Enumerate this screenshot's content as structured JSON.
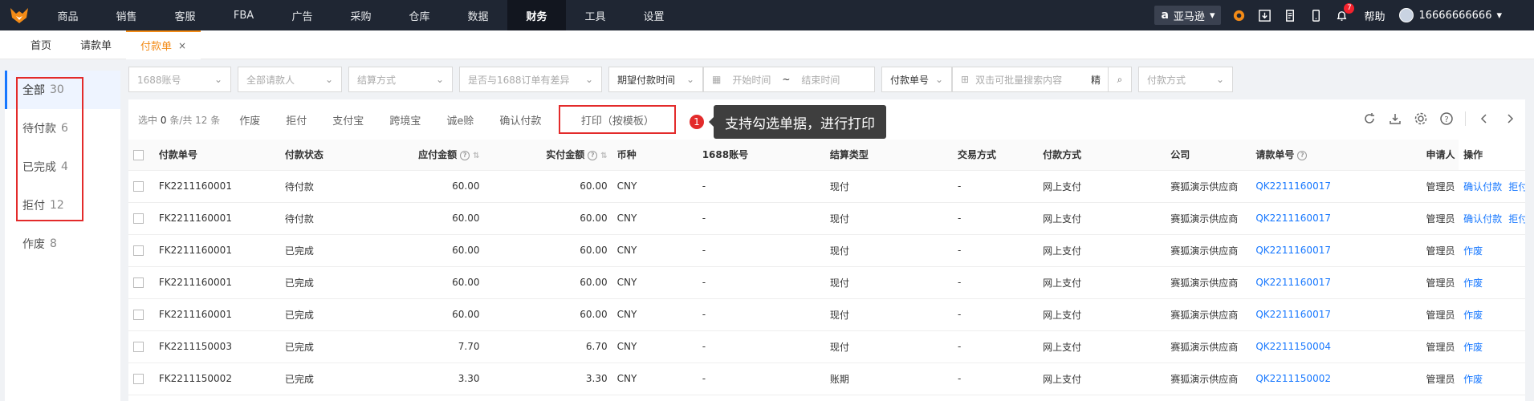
{
  "nav": {
    "items": [
      "商品",
      "销售",
      "客服",
      "FBA",
      "广告",
      "采购",
      "仓库",
      "数据",
      "财务",
      "工具",
      "设置"
    ],
    "active_index": 8,
    "platform": "亚马逊",
    "help": "帮助",
    "user": "16666666666",
    "notification_count": "7"
  },
  "tabs": [
    {
      "label": "首页"
    },
    {
      "label": "请款单"
    },
    {
      "label": "付款单",
      "close": "×"
    }
  ],
  "status_list": [
    {
      "label": "全部",
      "count": "30"
    },
    {
      "label": "待付款",
      "count": "6"
    },
    {
      "label": "已完成",
      "count": "4"
    },
    {
      "label": "拒付",
      "count": "12"
    },
    {
      "label": "作废",
      "count": "8"
    }
  ],
  "filters": {
    "account": "1688账号",
    "requester": "全部请款人",
    "settle": "结算方式",
    "diff": "是否与1688订单有差异",
    "date_type": "期望付款时间",
    "start": "开始时间",
    "tilde": "~",
    "end": "结束时间",
    "search_type": "付款单号",
    "search_placeholder": "双击可批量搜索内容",
    "exact": "精",
    "pay_method": "付款方式"
  },
  "toolbar": {
    "selected_prefix": "选中",
    "selected": "0",
    "selected_suffix": "条/共 12 条",
    "buttons": [
      "作废",
      "拒付",
      "支付宝",
      "跨境宝",
      "诚e赊",
      "确认付款"
    ],
    "print": "打印（按模板）",
    "step": "1",
    "tip": "支持勾选单据，进行打印"
  },
  "table": {
    "headers": {
      "no": "付款单号",
      "status": "付款状态",
      "payable": "应付金额",
      "actual": "实付金额",
      "currency": "币种",
      "account": "1688账号",
      "settle": "结算类型",
      "trade": "交易方式",
      "pay": "付款方式",
      "company": "公司",
      "req": "请款单号",
      "applicant": "申请人",
      "op": "操作"
    },
    "rows": [
      {
        "no": "FK2211160001",
        "status": "待付款",
        "payable": "60.00",
        "actual": "60.00",
        "currency": "CNY",
        "account": "-",
        "settle": "现付",
        "trade": "-",
        "pay": "网上支付",
        "company": "赛狐演示供应商",
        "req": "QK2211160017",
        "applicant": "管理员",
        "op1": "确认付款",
        "op2": "拒付"
      },
      {
        "no": "FK2211160001",
        "status": "待付款",
        "payable": "60.00",
        "actual": "60.00",
        "currency": "CNY",
        "account": "-",
        "settle": "现付",
        "trade": "-",
        "pay": "网上支付",
        "company": "赛狐演示供应商",
        "req": "QK2211160017",
        "applicant": "管理员",
        "op1": "确认付款",
        "op2": "拒付"
      },
      {
        "no": "FK2211160001",
        "status": "已完成",
        "payable": "60.00",
        "actual": "60.00",
        "currency": "CNY",
        "account": "-",
        "settle": "现付",
        "trade": "-",
        "pay": "网上支付",
        "company": "赛狐演示供应商",
        "req": "QK2211160017",
        "applicant": "管理员",
        "op1": "作废",
        "op2": ""
      },
      {
        "no": "FK2211160001",
        "status": "已完成",
        "payable": "60.00",
        "actual": "60.00",
        "currency": "CNY",
        "account": "-",
        "settle": "现付",
        "trade": "-",
        "pay": "网上支付",
        "company": "赛狐演示供应商",
        "req": "QK2211160017",
        "applicant": "管理员",
        "op1": "作废",
        "op2": ""
      },
      {
        "no": "FK2211160001",
        "status": "已完成",
        "payable": "60.00",
        "actual": "60.00",
        "currency": "CNY",
        "account": "-",
        "settle": "现付",
        "trade": "-",
        "pay": "网上支付",
        "company": "赛狐演示供应商",
        "req": "QK2211160017",
        "applicant": "管理员",
        "op1": "作废",
        "op2": ""
      },
      {
        "no": "FK2211150003",
        "status": "已完成",
        "payable": "7.70",
        "actual": "6.70",
        "currency": "CNY",
        "account": "-",
        "settle": "现付",
        "trade": "-",
        "pay": "网上支付",
        "company": "赛狐演示供应商",
        "req": "QK2211150004",
        "applicant": "管理员",
        "op1": "作废",
        "op2": ""
      },
      {
        "no": "FK2211150002",
        "status": "已完成",
        "payable": "3.30",
        "actual": "3.30",
        "currency": "CNY",
        "account": "-",
        "settle": "账期",
        "trade": "-",
        "pay": "网上支付",
        "company": "赛狐演示供应商",
        "req": "QK2211150002",
        "applicant": "管理员",
        "op1": "作废",
        "op2": ""
      }
    ]
  },
  "colors": {
    "accent": "#f38b17",
    "link": "#1677ff",
    "highlight": "#e32b2b",
    "nav_bg": "#1f2633"
  }
}
